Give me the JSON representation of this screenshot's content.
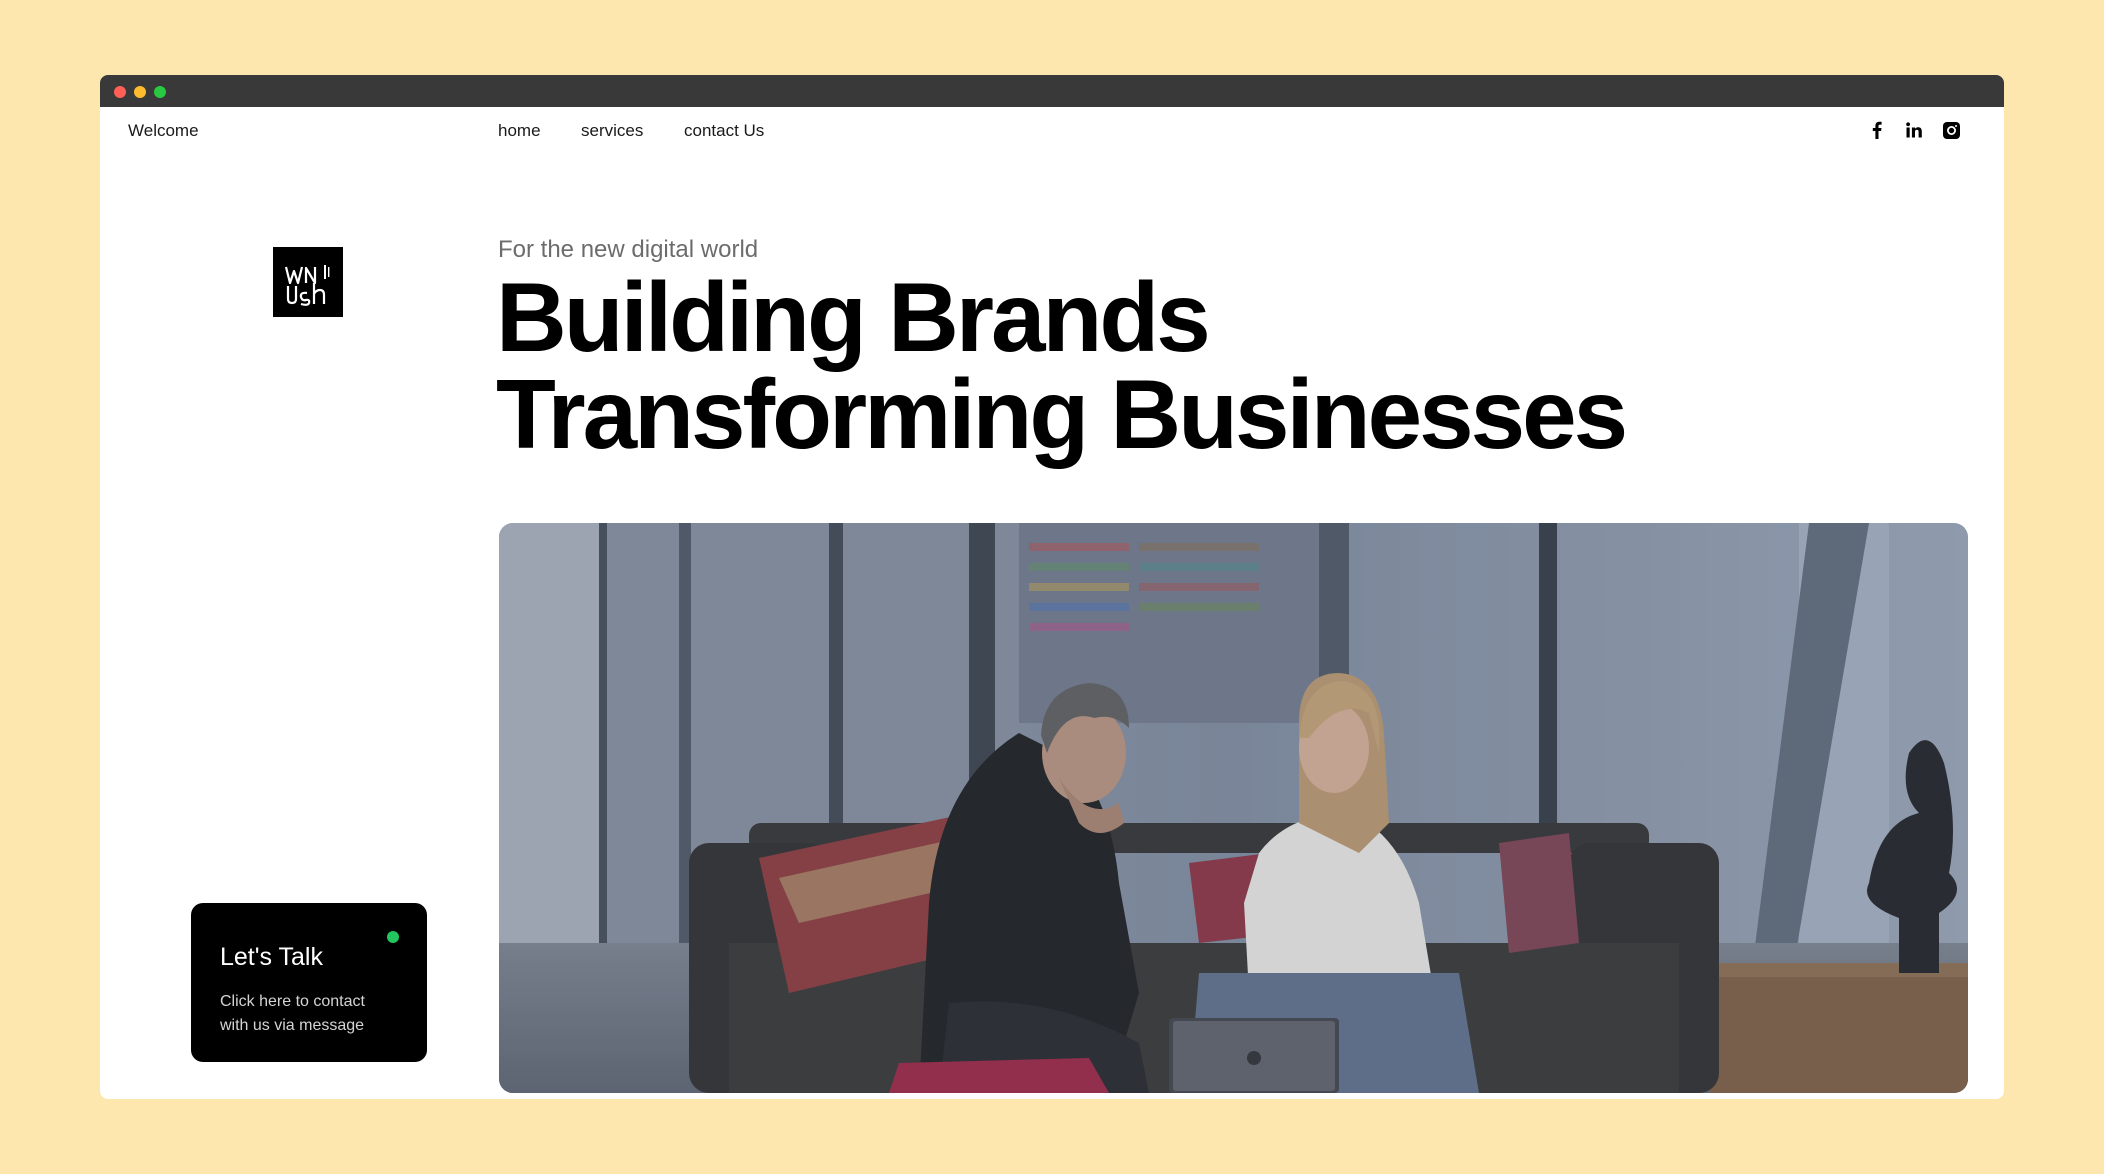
{
  "nav": {
    "welcome": "Welcome",
    "links": [
      "home",
      "services",
      "contact Us"
    ]
  },
  "social": {
    "icons": [
      "facebook-icon",
      "linkedin-icon",
      "instagram-icon"
    ]
  },
  "hero": {
    "eyebrow": "For the new digital world",
    "headline_line1": "Building Brands",
    "headline_line2": "Transforming Businesses",
    "image_alt": "Two people on a sofa looking at a laptop in a modern office"
  },
  "cta": {
    "title": "Let's Talk",
    "description": "Click here to contact with us via message",
    "status_color": "#22c55e"
  },
  "colors": {
    "page_background": "#fde7ae",
    "titlebar": "#393939",
    "text": "#000000"
  }
}
